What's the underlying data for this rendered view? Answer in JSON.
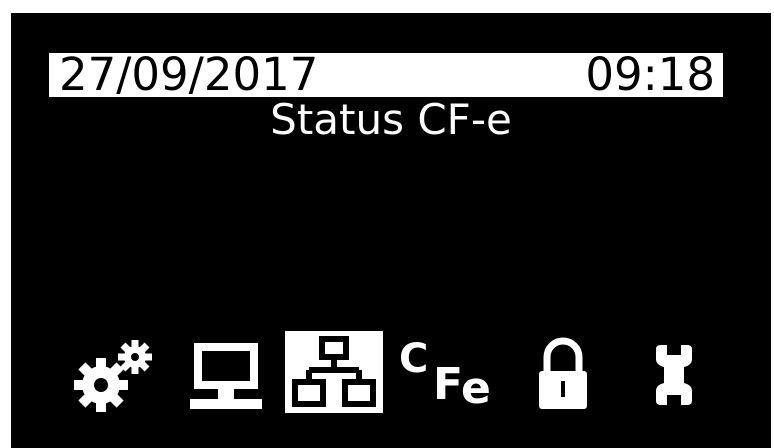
{
  "header": {
    "date": "27/09/2017",
    "time": "09:18"
  },
  "screen": {
    "title": "Status CF-e"
  },
  "menu": {
    "selected_index": 2,
    "items": [
      {
        "icon": "gears-icon"
      },
      {
        "icon": "computer-terminal-icon"
      },
      {
        "icon": "network-icon"
      },
      {
        "icon": "cfe-icon",
        "glyph_c": "C",
        "glyph_f": "F",
        "glyph_e": "e"
      },
      {
        "icon": "lock-icon"
      },
      {
        "icon": "wrench-icon"
      }
    ]
  },
  "colors": {
    "background": "#000000",
    "foreground": "#ffffff",
    "bezel": "#ffffff"
  }
}
